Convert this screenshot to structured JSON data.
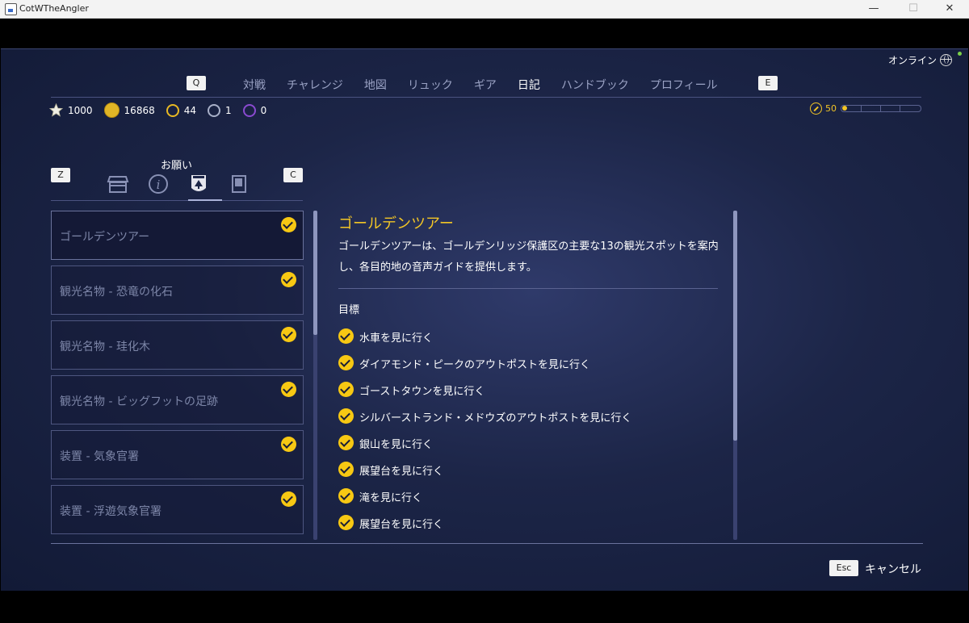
{
  "window": {
    "title": "CotWTheAngler",
    "minimize": "—",
    "maximize": "☐",
    "close": "✕"
  },
  "status": {
    "online": "オンライン"
  },
  "nav": {
    "prev_key": "Q",
    "next_key": "E",
    "tabs": [
      "対戦",
      "チャレンジ",
      "地図",
      "リュック",
      "ギア",
      "日記",
      "ハンドブック",
      "プロフィール"
    ],
    "active_tab": "日記"
  },
  "currency": {
    "stars": "1000",
    "coins": "16868",
    "gold_trophies": "44",
    "silver_trophies": "1",
    "purple_trophies": "0"
  },
  "level": {
    "value": "50",
    "progress": 0.05
  },
  "subnav": {
    "title": "お願い",
    "prev_key": "Z",
    "next_key": "C",
    "icons": [
      "shop-icon",
      "info-icon",
      "request-icon",
      "journal-icon"
    ]
  },
  "requests": [
    {
      "label": "ゴールデンツアー",
      "completed": true
    },
    {
      "label": "観光名物 - 恐竜の化石",
      "completed": true
    },
    {
      "label": "観光名物 - 珪化木",
      "completed": true
    },
    {
      "label": "観光名物 - ビッグフットの足跡",
      "completed": true
    },
    {
      "label": "装置 - 気象官署",
      "completed": true
    },
    {
      "label": "装置 - 浮遊気象官署",
      "completed": true
    }
  ],
  "detail": {
    "title": "ゴールデンツアー",
    "description": "ゴールデンツアーは、ゴールデンリッジ保護区の主要な13の観光スポットを案内し、各目的地の音声ガイドを提供します。",
    "objectives_heading": "目標",
    "objectives": [
      "水車を見に行く",
      "ダイアモンド・ピークのアウトポストを見に行く",
      "ゴーストタウンを見に行く",
      "シルバーストランド・メドウズのアウトポストを見に行く",
      "銀山を見に行く",
      "展望台を見に行く",
      "滝を見に行く",
      "展望台を見に行く"
    ]
  },
  "footer": {
    "esc_key": "Esc",
    "cancel_label": "キャンセル"
  },
  "colors": {
    "accent": "#f2c526",
    "background": "#1c2547",
    "text_dim": "#7d86a8"
  }
}
